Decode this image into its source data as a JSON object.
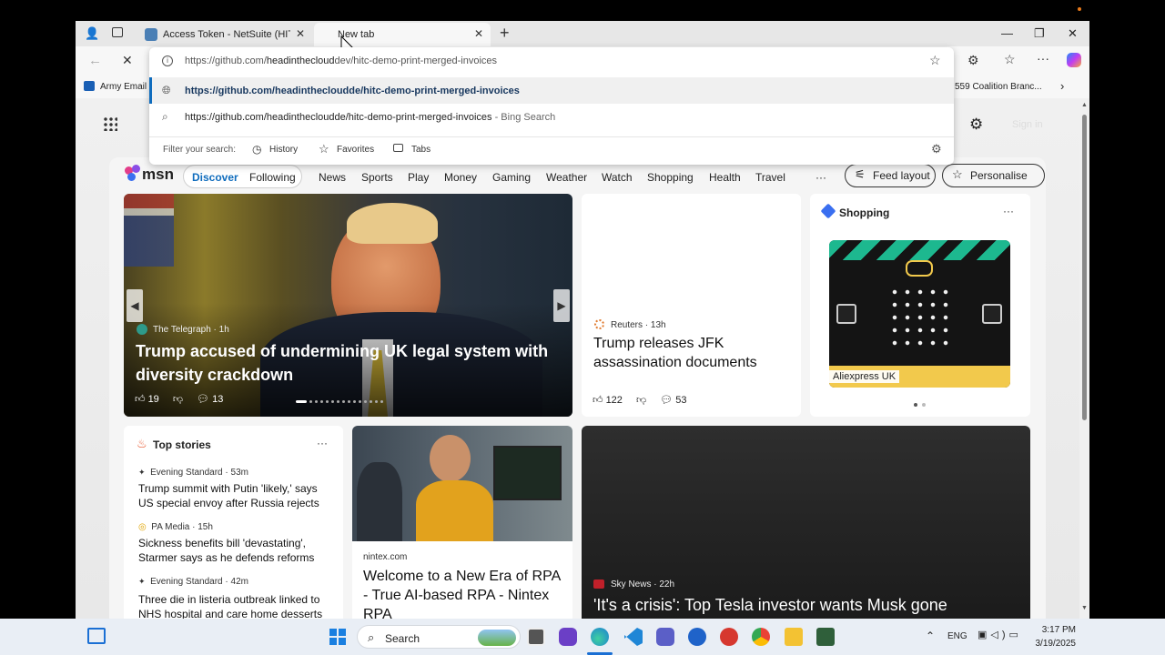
{
  "tabs": [
    {
      "title": "Access Token - NetSuite (HITC - D"
    },
    {
      "title": "New tab"
    }
  ],
  "address": {
    "url_prefix": "https://github.com/",
    "url_rest": "headinthecloud",
    "url_tail": "dev/hitc-demo-print-merged-invoices"
  },
  "suggestions": [
    {
      "text": "https://github.com/headinthecloudde/hitc-demo-print-merged-invoices"
    },
    {
      "text": "https://github.com/headinthecloudde/hitc-demo-print-merged-invoices",
      "suffix": "- Bing Search"
    }
  ],
  "filter": {
    "label": "Filter your search:",
    "history": "History",
    "favorites": "Favorites",
    "tabs": "Tabs"
  },
  "favorites_bar": {
    "left_item": "Army Email",
    "right_item": "559 Coalition Branc..."
  },
  "page_top": {
    "sign_in": "Sign in"
  },
  "msn": {
    "logo": "msn",
    "nav": [
      "Discover",
      "Following",
      "News",
      "Sports",
      "Play",
      "Money",
      "Gaming",
      "Weather",
      "Watch",
      "Shopping",
      "Health",
      "Travel"
    ],
    "more": "···",
    "feed_layout": "Feed layout",
    "personalise": "Personalise"
  },
  "hero": {
    "source": "The Telegraph",
    "time": "1h",
    "headline": "Trump accused of undermining UK legal system with diversity crackdown",
    "likes": "19",
    "comments": "13"
  },
  "reuters": {
    "source": "Reuters",
    "time": "13h",
    "headline": "Trump releases JFK assassination documents",
    "likes": "122",
    "comments": "53"
  },
  "shopping": {
    "title": "Shopping",
    "more": "···",
    "product_label": "Aliexpress UK"
  },
  "top_stories": {
    "title": "Top stories",
    "more": "···",
    "items": [
      {
        "source": "Evening Standard",
        "time": "53m",
        "headline": "Trump summit with Putin 'likely,' says US special envoy after Russia rejects 30-da..."
      },
      {
        "source": "PA Media",
        "time": "15h",
        "headline": "Sickness benefits bill 'devastating', Starmer says as he defends reforms"
      },
      {
        "source": "Evening Standard",
        "time": "42m",
        "headline": "Three die in listeria outbreak linked to NHS hospital and care home desserts"
      }
    ]
  },
  "nintex": {
    "source": "nintex.com",
    "headline": "Welcome to a New Era of RPA - True AI-based RPA - Nintex RPA"
  },
  "skynews": {
    "source": "Sky News",
    "time": "22h",
    "headline": "'It's a crisis': Top Tesla investor wants Musk gone"
  },
  "taskbar": {
    "search_placeholder": "Search",
    "lang": "ENG",
    "time": "3:17 PM",
    "date": "3/19/2025"
  },
  "colors": {
    "accent": "#0f6cbd",
    "taskbar": "#e9eef5"
  }
}
